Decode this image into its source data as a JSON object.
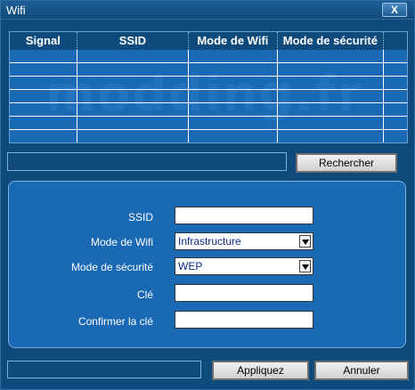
{
  "window": {
    "title": "Wifi",
    "close_label": "X"
  },
  "grid": {
    "columns": [
      "Signal",
      "SSID",
      "Mode de Wifi",
      "Mode de sécurité"
    ],
    "row_count": 7,
    "watermark": "modding.fr"
  },
  "search": {
    "value": "",
    "button_label": "Rechercher"
  },
  "form": {
    "ssid_label": "SSID",
    "ssid_value": "",
    "wifi_mode_label": "Mode de Wifi",
    "wifi_mode_value": "Infrastructure",
    "security_label": "Mode de sécurité",
    "security_value": "WEP",
    "key_label": "Clé",
    "key_value": "",
    "confirm_label": "Confirmer la clé",
    "confirm_value": ""
  },
  "footer": {
    "status": "",
    "apply_label": "Appliquez",
    "cancel_label": "Annuler"
  },
  "colors": {
    "window_bg": "#0f4a7d",
    "panel_bg": "#1a69b5",
    "border": "#7fb0dc"
  }
}
